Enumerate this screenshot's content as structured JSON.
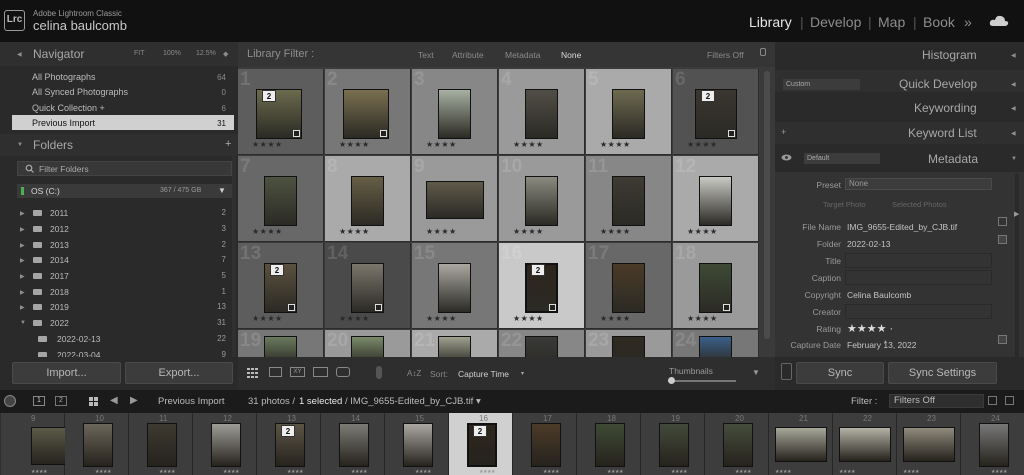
{
  "app": {
    "logo": "Lrc",
    "name": "Adobe Lightroom Classic",
    "user": "celina baulcomb"
  },
  "modules": [
    "Library",
    "Develop",
    "Map",
    "Book"
  ],
  "module_more": "»",
  "colors": {
    "accent_folder": "#4caf50",
    "selected_cell": "#c9c9c9"
  },
  "navigator": {
    "title": "Navigator",
    "fit": "FIT",
    "zoom1": "100%",
    "zoom2": "12.5%"
  },
  "catalog": [
    {
      "label": "All Photographs",
      "count": "64"
    },
    {
      "label": "All Synced Photographs",
      "count": "0"
    },
    {
      "label": "Quick Collection +",
      "count": "6"
    },
    {
      "label": "Previous Import",
      "count": "31"
    }
  ],
  "folders": {
    "title": "Folders",
    "filter_placeholder": "Filter Folders",
    "volume": {
      "name": "OS (C:)",
      "space": "367 / 475 GB"
    },
    "items": [
      {
        "name": "2011",
        "count": "2"
      },
      {
        "name": "2012",
        "count": "3"
      },
      {
        "name": "2013",
        "count": "2"
      },
      {
        "name": "2014",
        "count": "7"
      },
      {
        "name": "2017",
        "count": "5"
      },
      {
        "name": "2018",
        "count": "1"
      },
      {
        "name": "2019",
        "count": "13"
      },
      {
        "name": "2022",
        "count": "31"
      },
      {
        "name": "2022-02-13",
        "count": "22"
      },
      {
        "name": "2022-03-04",
        "count": "9"
      }
    ]
  },
  "left_buttons": {
    "import": "Import...",
    "export": "Export..."
  },
  "library_filter": {
    "title": "Library Filter :",
    "tabs": [
      "Text",
      "Attribute",
      "Metadata",
      "None"
    ],
    "status": "Filters Off"
  },
  "grid": {
    "numbers": [
      "1",
      "2",
      "3",
      "4",
      "5",
      "6",
      "7",
      "8",
      "9",
      "10",
      "11",
      "12",
      "13",
      "14",
      "15",
      "16",
      "17",
      "18",
      "19",
      "20",
      "21",
      "22",
      "23",
      "24"
    ],
    "stars_label": "★★★★",
    "stack_badge": "2"
  },
  "toolbar": {
    "sort_label": "Sort:",
    "sort_value": "Capture Time",
    "thumbnails_label": "Thumbnails",
    "sort_icon": "A↕Z"
  },
  "right_panel": {
    "histogram": "Histogram",
    "quick_develop": "Quick Develop",
    "quick_develop_preset": "Custom",
    "keywording": "Keywording",
    "keyword_list": "Keyword List",
    "metadata": "Metadata",
    "metadata_preset": "Default",
    "preset_label": "Preset",
    "preset_value": "None",
    "target_photo": "Target Photo",
    "selected_photos": "Selected Photos",
    "fields": [
      {
        "label": "File Name",
        "value": "IMG_9655-Edited_by_CJB.tif"
      },
      {
        "label": "Folder",
        "value": "2022-02-13"
      },
      {
        "label": "Title",
        "value": ""
      },
      {
        "label": "Caption",
        "value": ""
      },
      {
        "label": "Copyright",
        "value": "Celina Baulcomb"
      },
      {
        "label": "Creator",
        "value": ""
      },
      {
        "label": "Rating",
        "value": "★★★★ ·"
      },
      {
        "label": "Capture Date",
        "value": "February 13, 2022"
      }
    ],
    "sync": "Sync",
    "sync_settings": "Sync Settings"
  },
  "filmstrip_bar": {
    "page1": "1",
    "page2": "2",
    "source": "Previous Import",
    "summary": "31 photos /",
    "selected": "1 selected",
    "path": "/ IMG_9655-Edited_by_CJB.tif ▾",
    "filter_label": "Filter :",
    "filter_value": "Filters Off"
  },
  "filmstrip": {
    "numbers": [
      "9",
      "10",
      "11",
      "12",
      "13",
      "14",
      "15",
      "16",
      "17",
      "18",
      "19",
      "20",
      "21",
      "22",
      "23",
      "24"
    ]
  }
}
